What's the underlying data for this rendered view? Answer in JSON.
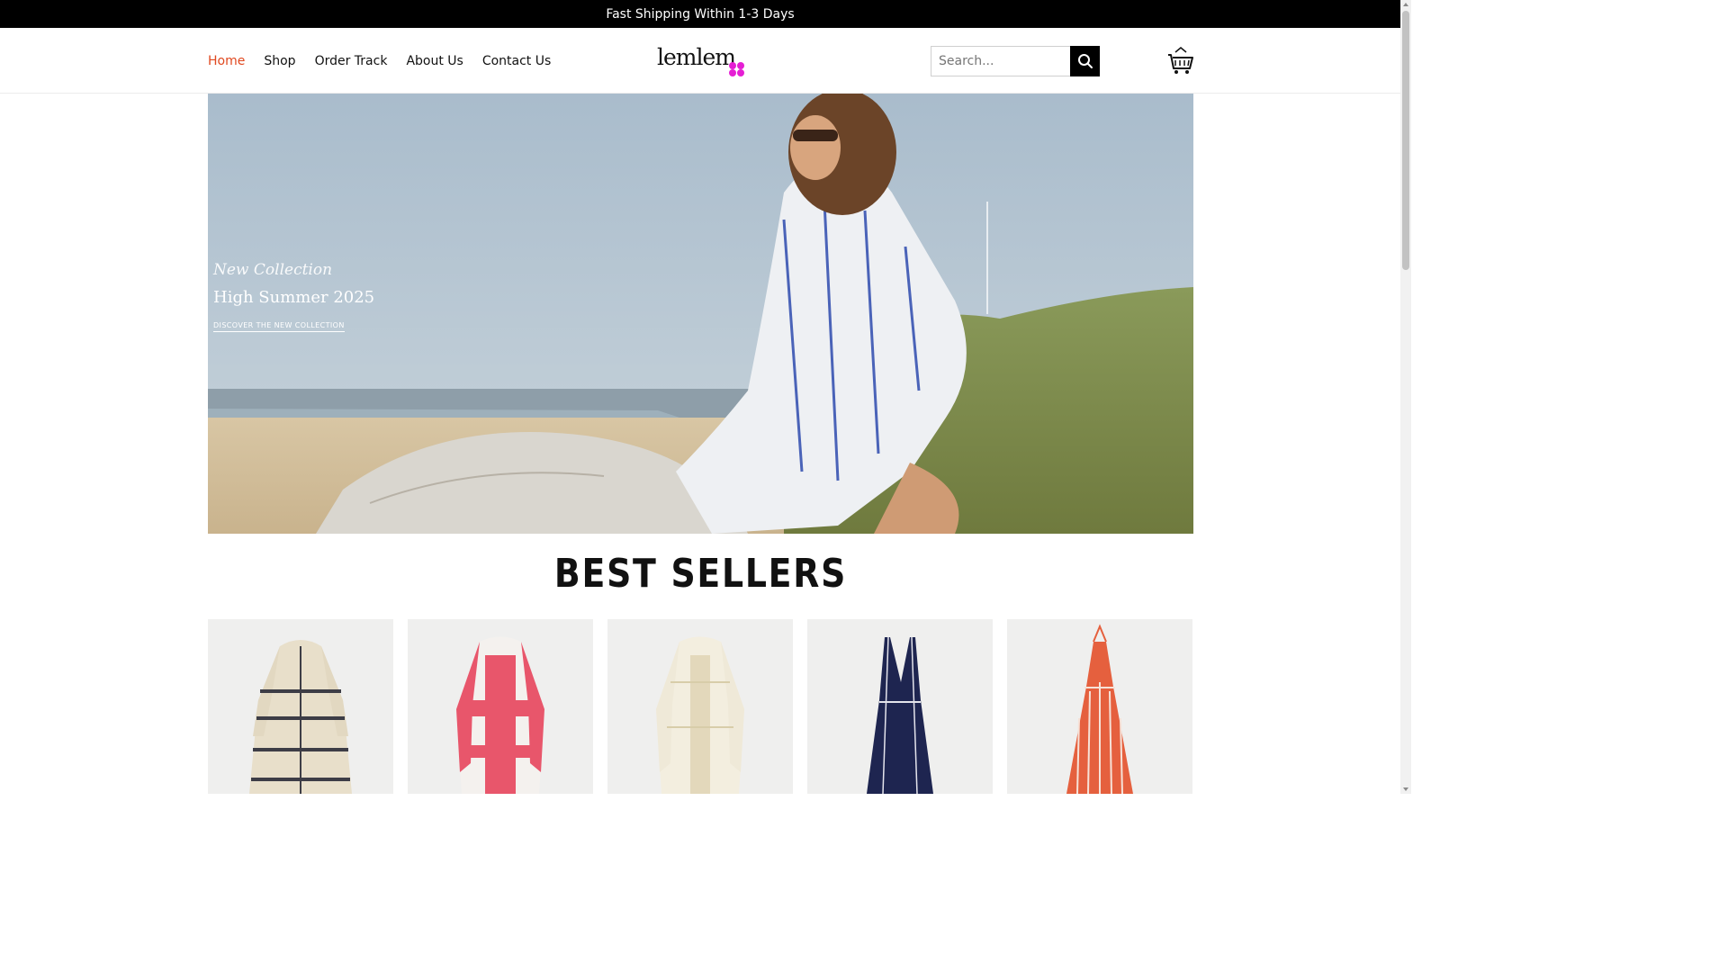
{
  "announcement": {
    "text": "Fast Shipping Within 1-3 Days"
  },
  "nav": {
    "items": [
      {
        "label": "Home",
        "active": true
      },
      {
        "label": "Shop",
        "active": false
      },
      {
        "label": "Order Track",
        "active": false
      },
      {
        "label": "About Us",
        "active": false
      },
      {
        "label": "Contact Us",
        "active": false
      }
    ]
  },
  "logo": {
    "text": "lemlem"
  },
  "search": {
    "placeholder": "Search..."
  },
  "hero": {
    "eyebrow": "New Collection",
    "title": "High Summer 2025",
    "cta": "DISCOVER THE NEW COLLECTION"
  },
  "best_sellers": {
    "title": "BEST SELLERS"
  },
  "products": [
    {
      "name": "cream-striped-dress",
      "color": "#e8dfca",
      "stripe": "#3d3d46"
    },
    {
      "name": "pink-striped-dress",
      "color": "#f4f1ee",
      "stripe": "#e8566b"
    },
    {
      "name": "ivory-embroidered-dress",
      "color": "#efe9d8",
      "stripe": "#e3d8bb"
    },
    {
      "name": "navy-halter-dress",
      "color": "#1e2550",
      "stripe": "#e4e4ec"
    },
    {
      "name": "coral-halter-dress",
      "color": "#e5603e",
      "stripe": "#f6e2d8"
    }
  ],
  "colors": {
    "accent": "#e0481f",
    "logo_dots": "#e51fd4"
  }
}
